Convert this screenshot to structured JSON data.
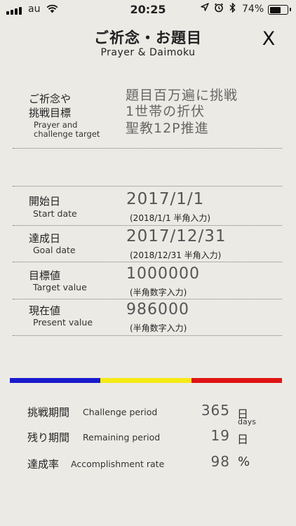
{
  "status_bar": {
    "carrier": "au",
    "time": "20:25",
    "battery_percent_text": "74%",
    "battery_level": 0.74,
    "icons": [
      "signal-icon",
      "wifi-icon",
      "location-arrow-icon",
      "alarm-icon",
      "bluetooth-icon",
      "battery-icon"
    ]
  },
  "header": {
    "title_ja": "ご祈念・お題目",
    "title_en": "Prayer & Daimoku",
    "close_label": "X"
  },
  "goal": {
    "label_ja_line1": "ご祈念や",
    "label_ja_line2": "挑戦目標",
    "label_en_line1": "Prayer and",
    "label_en_line2": "challenge target",
    "lines": [
      "題目百万遍に挑戦",
      "1世帯の折伏",
      "聖教12P推進"
    ]
  },
  "start": {
    "label_ja": "開始日",
    "label_en": "Start date",
    "value": "2017/1/1",
    "hint": "(2018/1/1 半角入力)"
  },
  "end": {
    "label_ja": "達成日",
    "label_en": "Goal date",
    "value": "2017/12/31",
    "hint": "(2018/12/31 半角入力)"
  },
  "target": {
    "label_ja": "目標値",
    "label_en": "Target value",
    "value": "1000000",
    "hint": "(半角数字入力)"
  },
  "present": {
    "label_ja": "現在値",
    "label_en": "Present value",
    "value": "986000",
    "hint": "(半角数字入力)"
  },
  "progress_colors": [
    "#1a1acc",
    "#f5ea14",
    "#e01414"
  ],
  "stats": {
    "period_ja": "挑戦期間",
    "period_en": "Challenge period",
    "period_value": "365",
    "period_unit": "日",
    "period_unit_en": "days",
    "remaining_ja": "残り期間",
    "remaining_en": "Remaining period",
    "remaining_value": "19",
    "remaining_unit": "日",
    "rate_ja": "達成率",
    "rate_en": "Accomplishment rate",
    "rate_value": "98",
    "rate_unit": "%"
  }
}
